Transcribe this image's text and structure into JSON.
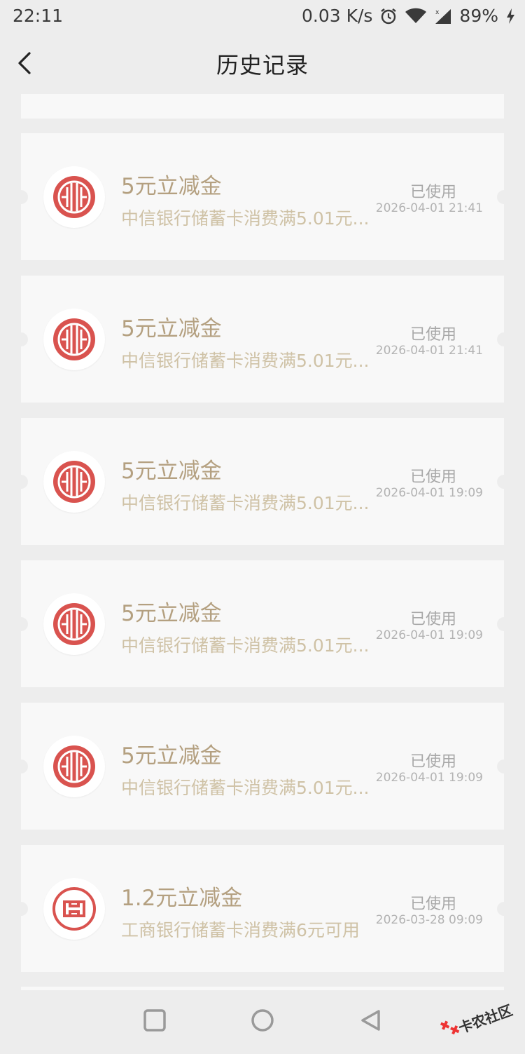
{
  "status_bar": {
    "time": "22:11",
    "speed": "0.03 K/s",
    "battery": "89%"
  },
  "header": {
    "title": "历史记录"
  },
  "coupons": [
    {
      "title": "5元立减金",
      "desc": "中信银行储蓄卡消费满5.01元...",
      "status": "已使用",
      "time": "2026-04-01 21:41",
      "bank_icon": "citic-bank-logo"
    },
    {
      "title": "5元立减金",
      "desc": "中信银行储蓄卡消费满5.01元...",
      "status": "已使用",
      "time": "2026-04-01 21:41",
      "bank_icon": "citic-bank-logo"
    },
    {
      "title": "5元立减金",
      "desc": "中信银行储蓄卡消费满5.01元...",
      "status": "已使用",
      "time": "2026-04-01 19:09",
      "bank_icon": "citic-bank-logo"
    },
    {
      "title": "5元立减金",
      "desc": "中信银行储蓄卡消费满5.01元...",
      "status": "已使用",
      "time": "2026-04-01 19:09",
      "bank_icon": "citic-bank-logo"
    },
    {
      "title": "5元立减金",
      "desc": "中信银行储蓄卡消费满5.01元...",
      "status": "已使用",
      "time": "2026-04-01 19:09",
      "bank_icon": "citic-bank-logo"
    },
    {
      "title": "1.2元立减金",
      "desc": "工商银行储蓄卡消费满6元可用",
      "status": "已使用",
      "time": "2026-03-28 09:09",
      "bank_icon": "icbc-bank-logo"
    }
  ],
  "watermark": {
    "text": "卡农社区"
  },
  "colors": {
    "logo_red": "#d9534f",
    "title_gold": "#b4a080",
    "desc_gold": "#cfc2a6"
  }
}
